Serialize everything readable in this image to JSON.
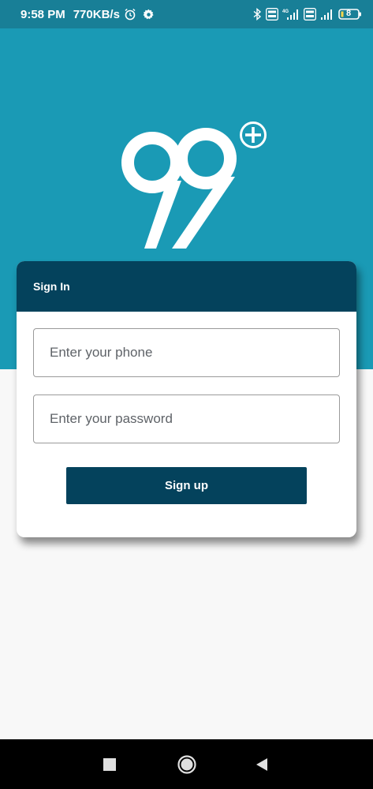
{
  "status_bar": {
    "time": "9:58 PM",
    "net_speed": "770KB/s",
    "battery": "8",
    "icons": [
      "alarm-icon",
      "gear-icon",
      "bluetooth-icon",
      "volte-icon",
      "4g-signal-icon",
      "volte-icon",
      "signal-icon",
      "battery-icon"
    ]
  },
  "brand": {
    "logo_name": "99-plus-logo",
    "primary_color": "#1a9ab5",
    "dark_color": "#04425c"
  },
  "signin": {
    "title": "Sign In",
    "phone_placeholder": "Enter your phone",
    "password_placeholder": "Enter your password",
    "submit_label": "Sign up"
  },
  "nav_bar": {
    "buttons": [
      "recent-apps-icon",
      "home-icon",
      "back-icon"
    ]
  }
}
